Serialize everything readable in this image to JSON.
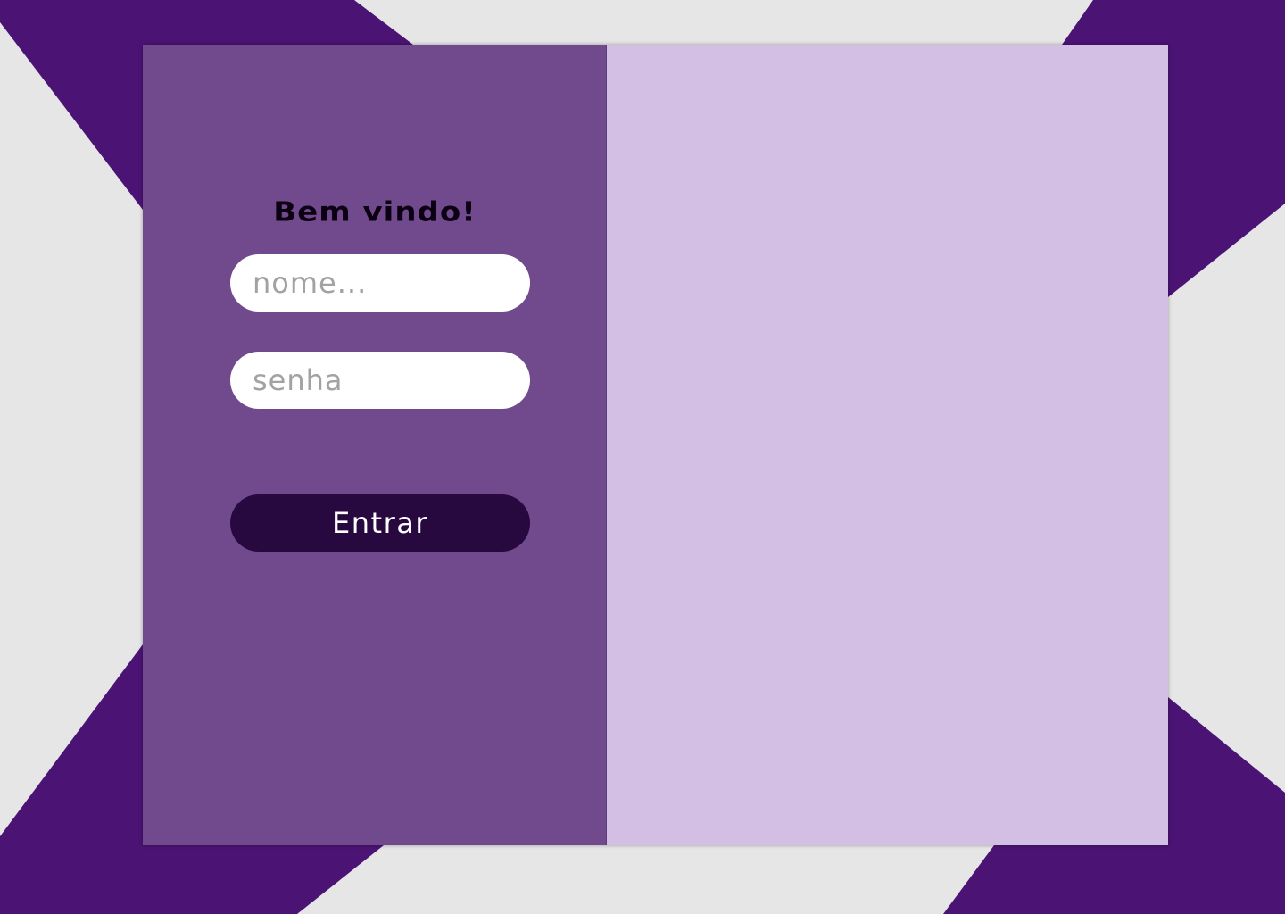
{
  "login": {
    "title": "Bem vindo!",
    "name_placeholder": "nome...",
    "password_placeholder": "senha",
    "submit_label": "Entrar"
  },
  "colors": {
    "page_background": "#e6e6e6",
    "stripe_purple": "#4b1374",
    "panel_left": "#704a8d",
    "panel_right": "#d2bfe3",
    "button": "#270940",
    "input_background": "#ffffff"
  }
}
